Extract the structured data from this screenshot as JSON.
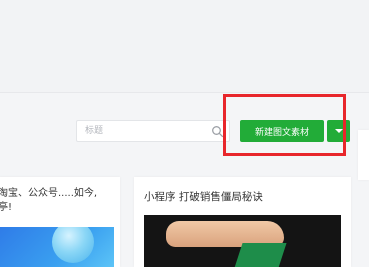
{
  "toolbar": {
    "search_placeholder": "标题",
    "new_button_label": "新建图文素材"
  },
  "cards": [
    {
      "title_line1": "淘宝、公众号.....如今,",
      "title_line2": "亭!"
    },
    {
      "title": "小程序 打破销售僵局秘诀"
    }
  ],
  "colors": {
    "accent_green": "#22ac38",
    "highlight_red": "#e8262b"
  },
  "icons": {
    "search": "search-icon",
    "dropdown": "chevron-down-icon"
  }
}
